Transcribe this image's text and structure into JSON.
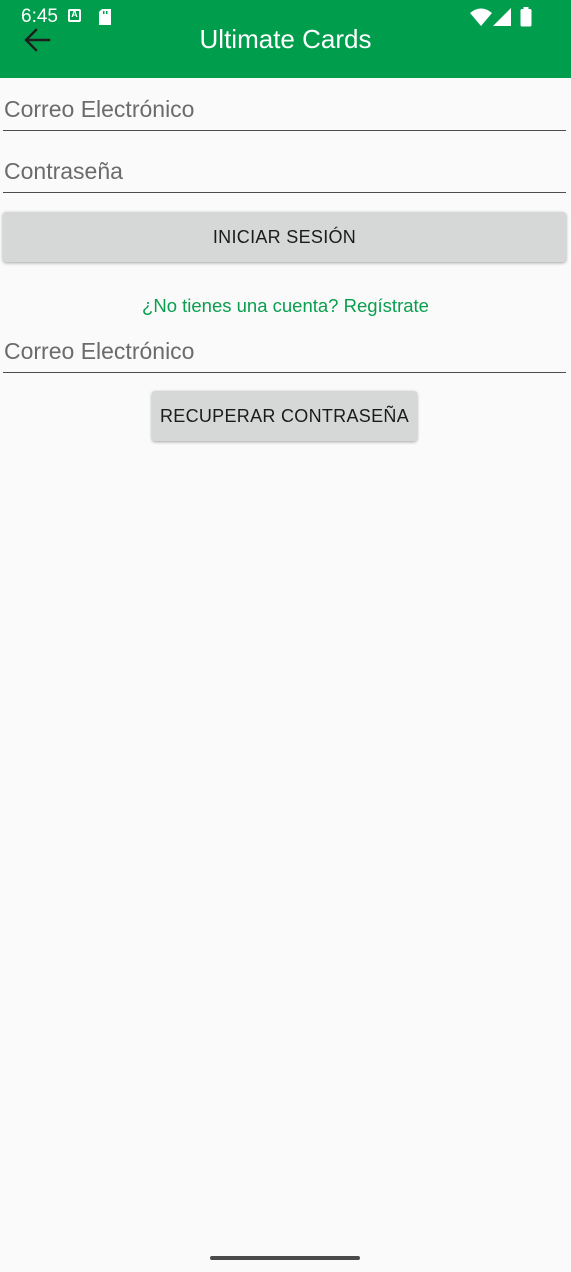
{
  "status_bar": {
    "time": "6:45"
  },
  "app_bar": {
    "title": "Ultimate Cards",
    "back_icon": "arrow-back-icon",
    "color": "#009e4c"
  },
  "login_form": {
    "email_placeholder": "Correo Electrónico",
    "password_placeholder": "Contraseña",
    "login_button": "INICIAR SESIÓN",
    "register_link": "¿No tienes una cuenta? Regístrate"
  },
  "recovery_form": {
    "email_placeholder": "Correo Electrónico",
    "recover_button": "RECUPERAR CONTRASEÑA"
  }
}
